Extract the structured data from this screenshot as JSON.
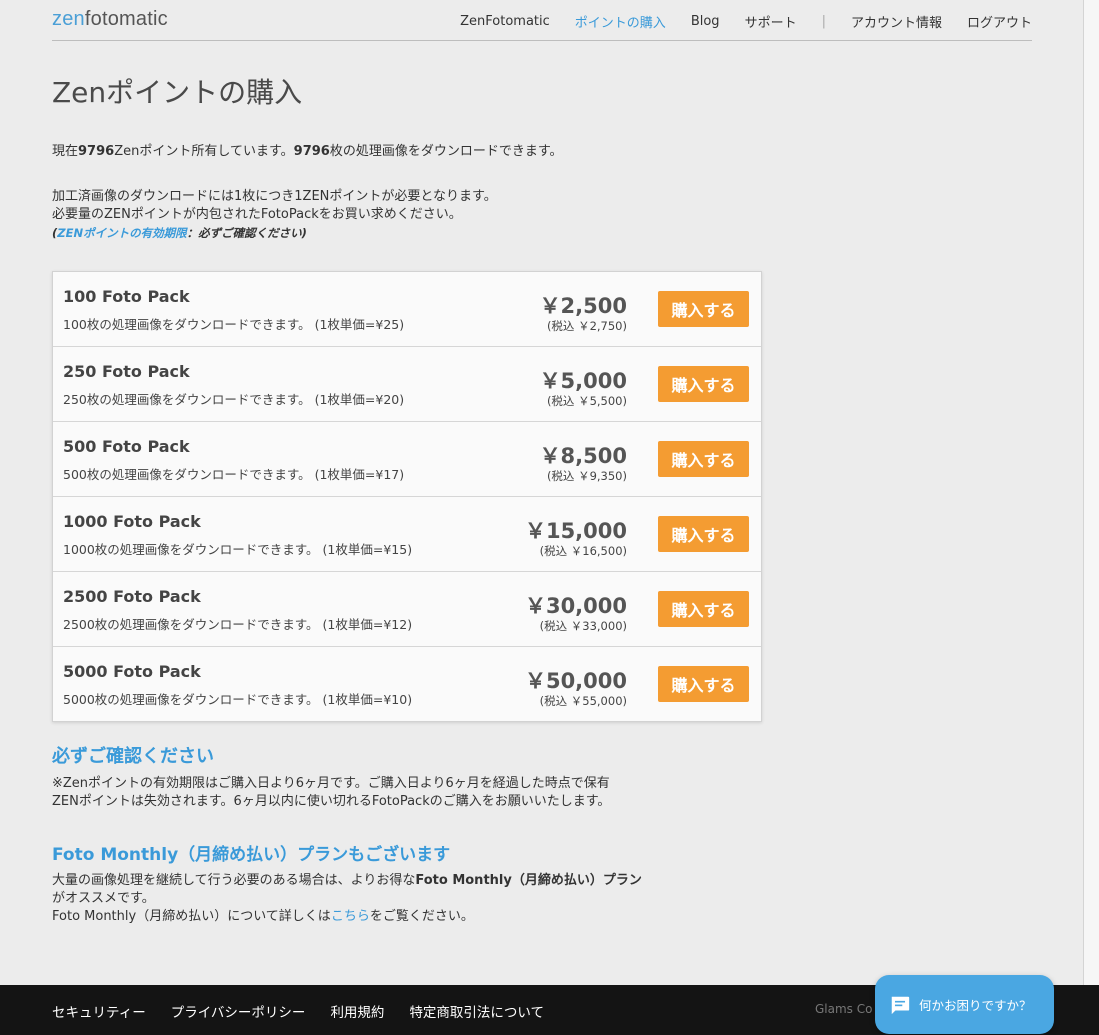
{
  "header": {
    "logo_prefix": "zen",
    "logo_suffix": "fotomatic",
    "nav": [
      {
        "label": "ZenFotomatic",
        "active": false
      },
      {
        "label": "ポイントの購入",
        "active": true
      },
      {
        "label": "Blog",
        "active": false
      },
      {
        "label": "サポート",
        "active": false
      }
    ],
    "separator": "|",
    "account": "アカウント情報",
    "logout": "ログアウト"
  },
  "page_title": "Zenポイントの購入",
  "summary": {
    "prefix": "現在",
    "points": "9796",
    "middle": "Zenポイント所有しています。",
    "images": "9796",
    "suffix": "枚の処理画像をダウンロードできます。"
  },
  "info": {
    "line1": "加工済画像のダウンロードには1枚につき1ZENポイントが必要となります。",
    "line2": "必要量のZENポイントが内包されたFotoPackをお買い求めください。",
    "note_open": "(",
    "note_link": "ZENポイントの有効期限",
    "note_rest": "：必ずご確認ください)"
  },
  "buy_label": "購入する",
  "packs": [
    {
      "name": "100 Foto Pack",
      "desc": "100枚の処理画像をダウンロードできます。 (1枚単価=¥25)",
      "price": "￥2,500",
      "tax": "(税込 ￥2,750)"
    },
    {
      "name": "250 Foto Pack",
      "desc": "250枚の処理画像をダウンロードできます。 (1枚単価=¥20)",
      "price": "￥5,000",
      "tax": "(税込 ￥5,500)"
    },
    {
      "name": "500 Foto Pack",
      "desc": "500枚の処理画像をダウンロードできます。 (1枚単価=¥17)",
      "price": "￥8,500",
      "tax": "(税込 ￥9,350)"
    },
    {
      "name": "1000 Foto Pack",
      "desc": "1000枚の処理画像をダウンロードできます。 (1枚単価=¥15)",
      "price": "￥15,000",
      "tax": "(税込 ￥16,500)"
    },
    {
      "name": "2500 Foto Pack",
      "desc": "2500枚の処理画像をダウンロードできます。 (1枚単価=¥12)",
      "price": "￥30,000",
      "tax": "(税込 ￥33,000)"
    },
    {
      "name": "5000 Foto Pack",
      "desc": "5000枚の処理画像をダウンロードできます。 (1枚単価=¥10)",
      "price": "￥50,000",
      "tax": "(税込 ￥55,000)"
    }
  ],
  "confirm": {
    "title": "必ずご確認ください",
    "line1": "※Zenポイントの有効期限はご購入日より6ヶ月です。ご購入日より6ヶ月を経過した時点で保有",
    "line2": "ZENポイントは失効されます。6ヶ月以内に使い切れるFotoPackのご購入をお願いいたします。"
  },
  "monthly": {
    "title": "Foto Monthly（月締め払い）プランもございます",
    "line1_a": "大量の画像処理を継続して行う必要のある場合は、よりお得な",
    "line1_b": "Foto Monthly（月締め払い）プラン",
    "line1_c": "がオススメです。",
    "line2_a": "Foto Monthly（月締め払い）について詳しくは",
    "line2_link": "こちら",
    "line2_c": "をご覧ください。"
  },
  "footer": {
    "links": [
      "セキュリティー",
      "プライバシーポリシー",
      "利用規約",
      "特定商取引法について"
    ],
    "copyright": "Glams Co"
  },
  "chat": {
    "label": "何かお困りですか？",
    "icon": "chat-bubble-icon"
  },
  "colors": {
    "accent": "#3a9ad9",
    "button": "#f49c32",
    "footer": "#141414",
    "chat": "#4aa7e2"
  }
}
